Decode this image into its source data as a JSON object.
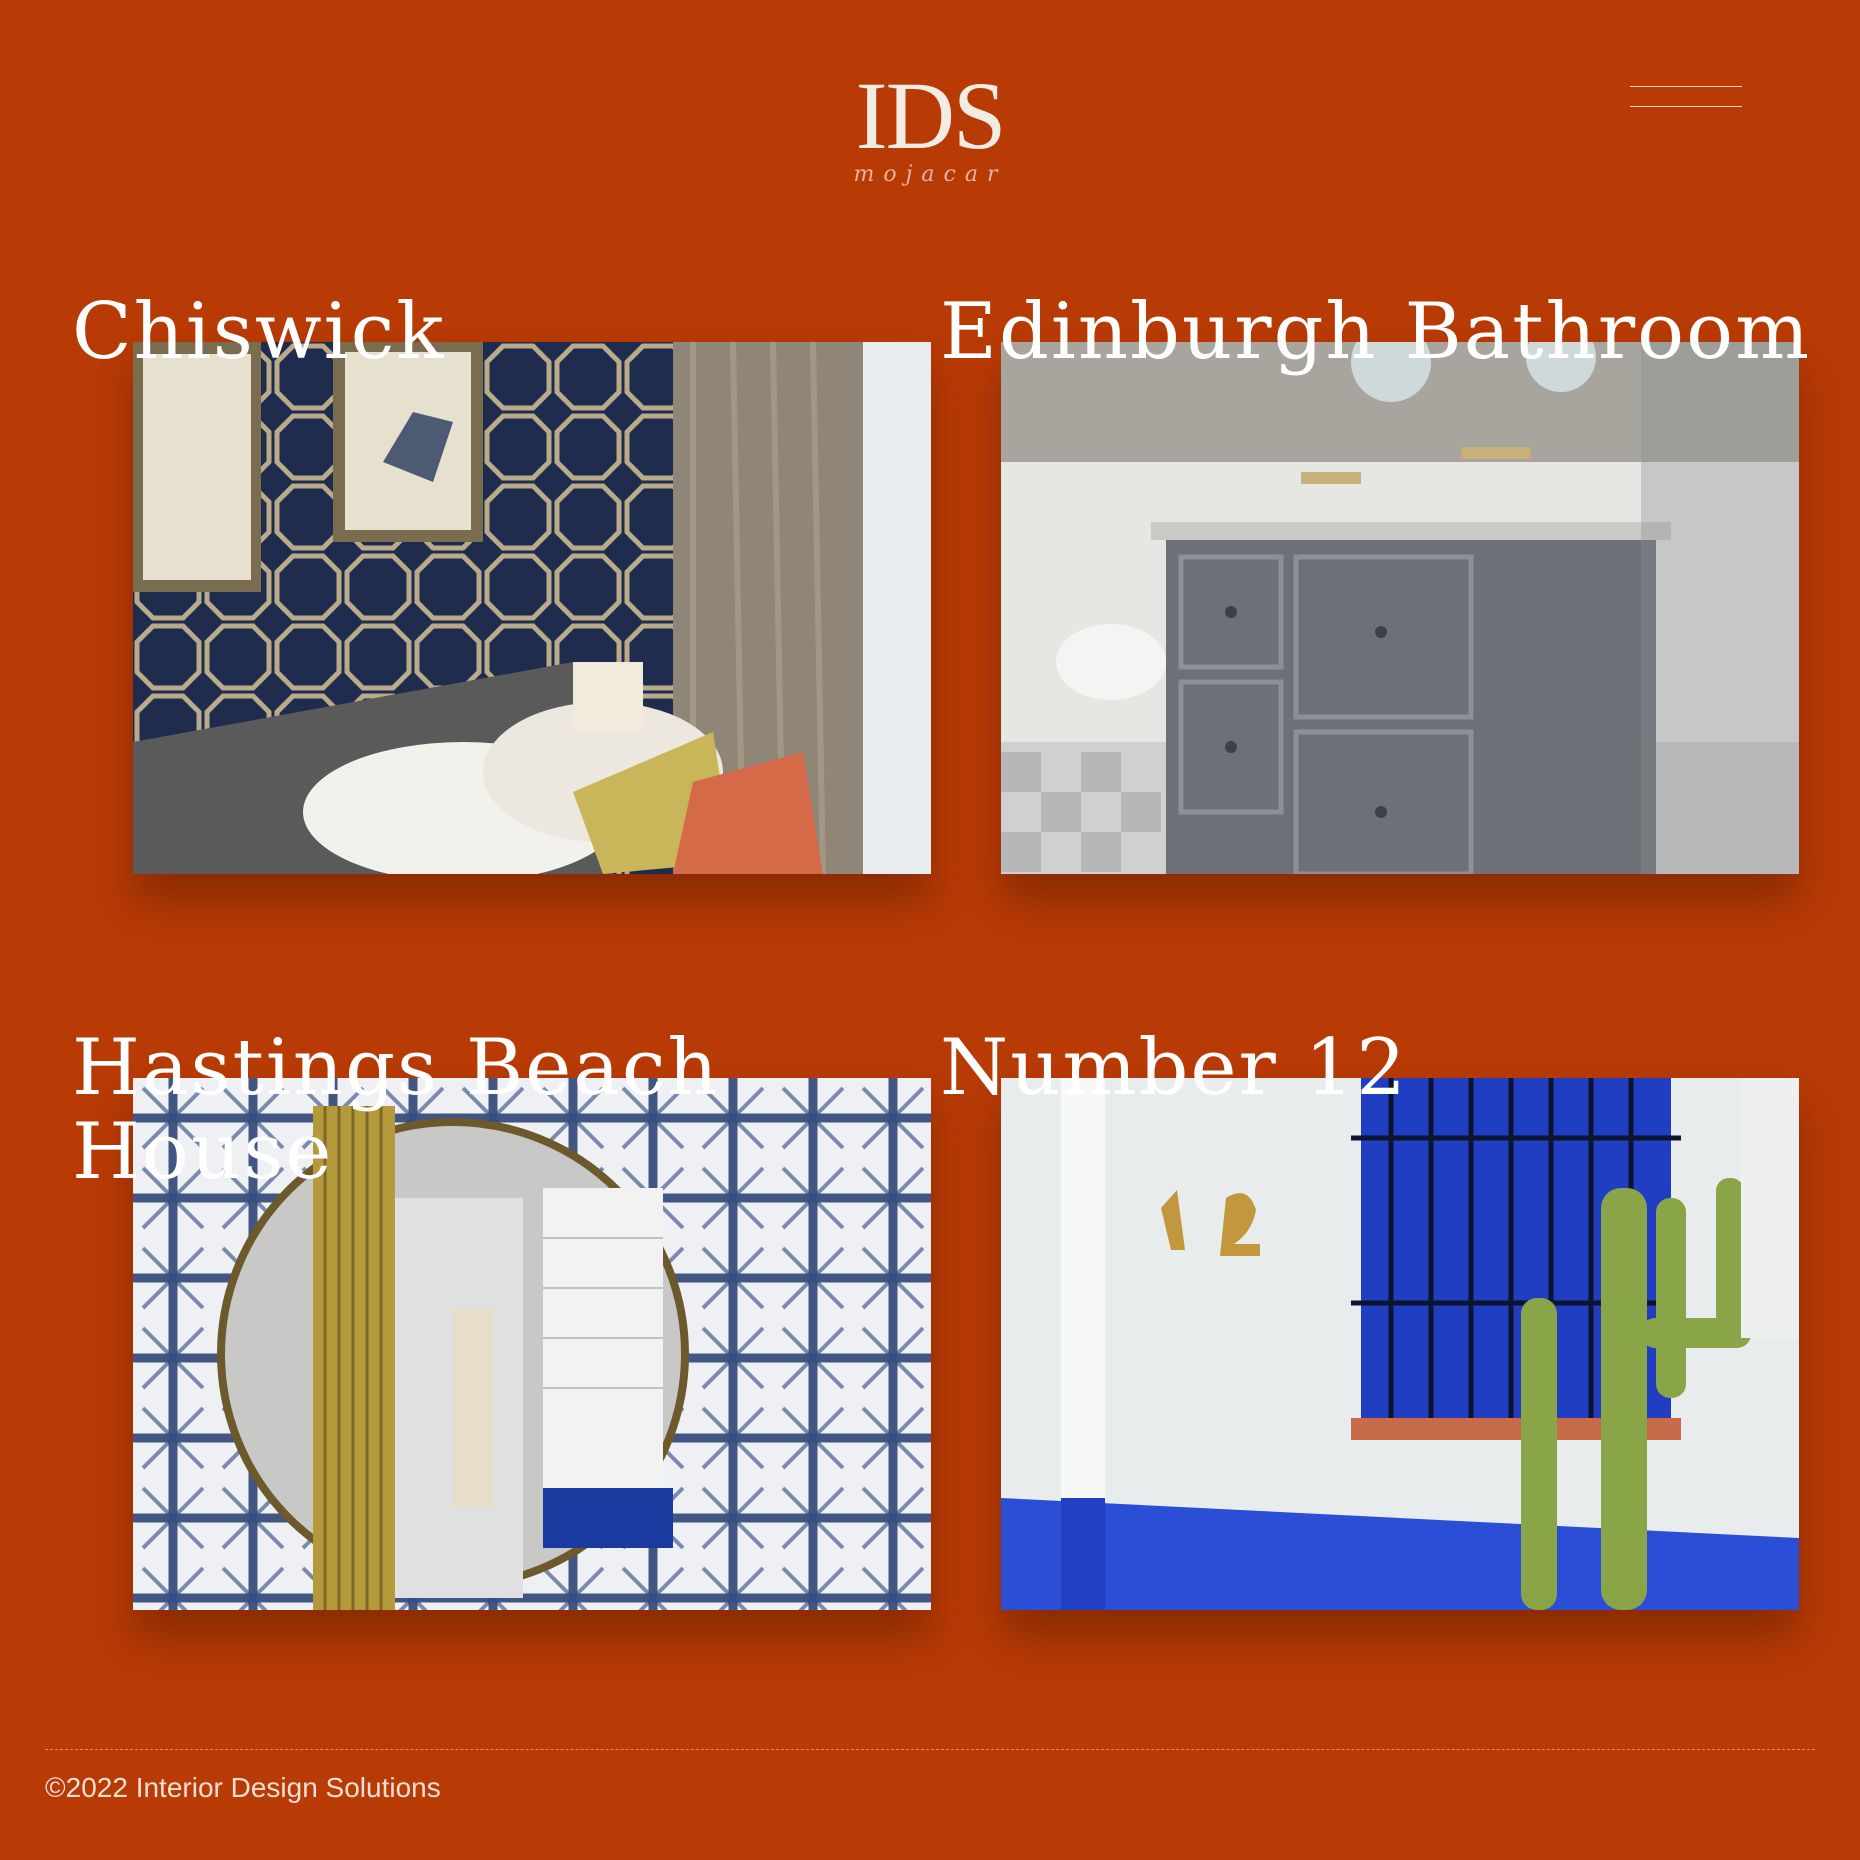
{
  "brand": {
    "logo_text": "IDS",
    "logo_subtext": "mojacar"
  },
  "colors": {
    "background": "#b83a05",
    "text": "#ffffff"
  },
  "header": {
    "menu_icon": "hamburger-icon"
  },
  "projects": [
    {
      "title": "Chiswick",
      "image": "bedroom-navy-geometric-wallpaper-photo"
    },
    {
      "title": "Edinburgh Bathroom",
      "image": "grey-vanity-bathroom-photo"
    },
    {
      "title": "Hastings Beach\nHouse",
      "image": "shibori-tile-bathroom-mirror-photo"
    },
    {
      "title": "Number 12",
      "image": "white-wall-blue-window-cactus-photo"
    }
  ],
  "footer": {
    "copyright": "©2022 Interior Design Solutions"
  }
}
